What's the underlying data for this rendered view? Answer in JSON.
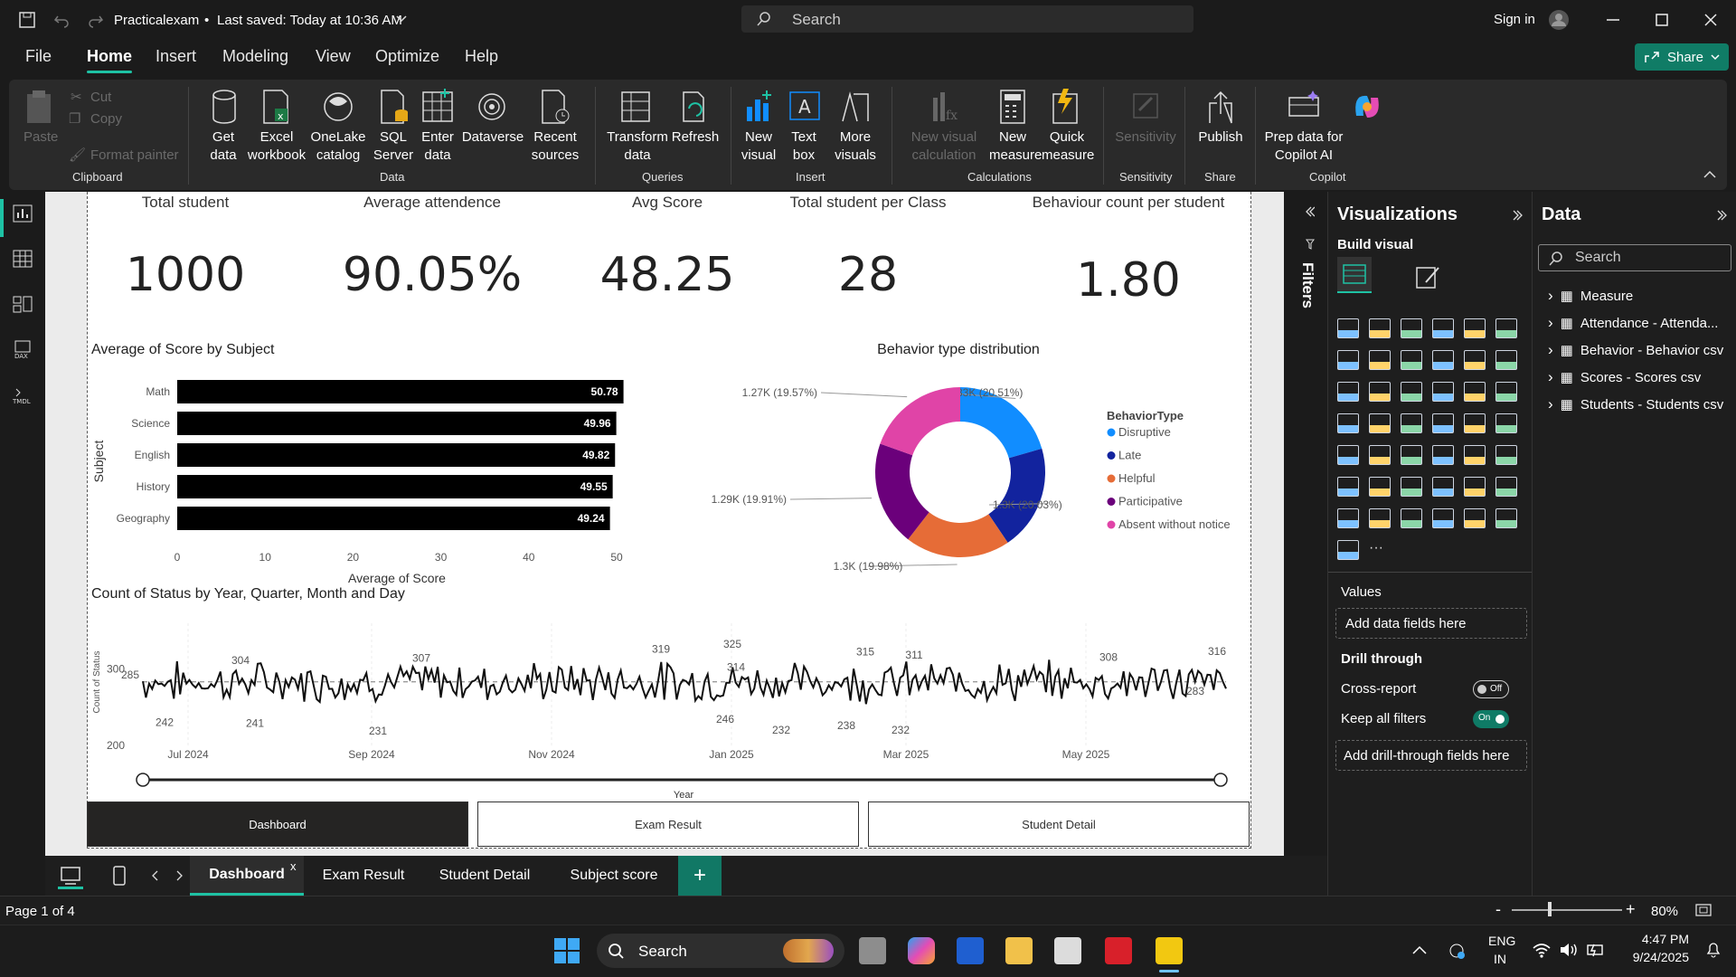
{
  "window": {
    "file_name": "Practicalexam",
    "saved": "Last saved: Today at 10:36 AM",
    "search_placeholder": "Search",
    "sign_in": "Sign in"
  },
  "menu": [
    "File",
    "Home",
    "Insert",
    "Modeling",
    "View",
    "Optimize",
    "Help"
  ],
  "share_label": "Share",
  "ribbon": {
    "clipboard": {
      "paste": "Paste",
      "cut": "Cut",
      "copy": "Copy",
      "format_painter": "Format painter",
      "group": "Clipboard"
    },
    "data": {
      "get_data": "Get data",
      "excel": "Excel workbook",
      "onelake": "OneLake catalog",
      "sql": "SQL Server",
      "enter": "Enter data",
      "dataverse": "Dataverse",
      "recent": "Recent sources",
      "group": "Data"
    },
    "queries": {
      "transform": "Transform data",
      "refresh": "Refresh",
      "group": "Queries"
    },
    "insert": {
      "new_visual": "New visual",
      "text_box": "Text box",
      "more": "More visuals",
      "group": "Insert"
    },
    "calculations": {
      "new_calc": "New visual calculation",
      "new_measure": "New measure",
      "quick_measure": "Quick measure",
      "group": "Calculations"
    },
    "sensitivity": {
      "label": "Sensitivity",
      "group": "Sensitivity"
    },
    "share": {
      "publish": "Publish",
      "group": "Share"
    },
    "copilot": {
      "prep": "Prep data for Copilot AI",
      "group": "Copilot"
    }
  },
  "cards": [
    {
      "title": "Total student",
      "value": "1000"
    },
    {
      "title": "Average attendence",
      "value": "90.05%"
    },
    {
      "title": "Avg Score",
      "value": "48.25"
    },
    {
      "title": "Total student per Class",
      "value": "28"
    },
    {
      "title": "Behaviour count per student",
      "value": "1.80"
    }
  ],
  "bar_chart": {
    "title": "Average of Score by Subject",
    "xlabel": "Average of Score",
    "ylabel": "Subject",
    "ticks": [
      "0",
      "10",
      "20",
      "30",
      "40",
      "50"
    ],
    "categories": [
      "Math",
      "Science",
      "English",
      "History",
      "Geography"
    ],
    "values": [
      50.78,
      49.96,
      49.82,
      49.55,
      49.24
    ],
    "labels": [
      "50.78",
      "49.96",
      "49.82",
      "49.55",
      "49.24"
    ],
    "color": "#000000"
  },
  "donut": {
    "title": "Behavior type distribution",
    "legend_title": "BehaviorType",
    "items": [
      {
        "name": "Disruptive",
        "label": "1.33K (20.51%)",
        "pct": 20.51,
        "color": "#118DFF"
      },
      {
        "name": "Late",
        "label": "1.3K (20.03%)",
        "pct": 20.03,
        "color": "#12239E"
      },
      {
        "name": "Helpful",
        "label": "1.3K (19.98%)",
        "pct": 19.98,
        "color": "#E66C37"
      },
      {
        "name": "Participative",
        "label": "1.29K (19.91%)",
        "pct": 19.91,
        "color": "#6B007B"
      },
      {
        "name": "Absent without notice",
        "label": "1.27K (19.57%)",
        "pct": 19.57,
        "color": "#E044A7"
      }
    ]
  },
  "line_chart": {
    "title": "Count of Status by Year, Quarter, Month and Day",
    "ylabel": "Count of Status",
    "xlabel": "Year",
    "yticks": [
      "300",
      "200"
    ],
    "xticks": [
      "Jul 2024",
      "Sep 2024",
      "Nov 2024",
      "Jan 2025",
      "Mar 2025",
      "May 2025"
    ],
    "annotations": [
      "285",
      "304",
      "307",
      "319",
      "325",
      "315",
      "311",
      "308",
      "316",
      "242",
      "241",
      "231",
      "246",
      "232",
      "238",
      "232",
      "283",
      "314"
    ],
    "ylim": [
      200,
      330
    ]
  },
  "nav_buttons": [
    "Dashboard",
    "Exam Result",
    "Student Detail"
  ],
  "filters_label": "Filters",
  "viz_pane": {
    "title": "Visualizations",
    "build": "Build visual",
    "values": "Values",
    "add_fields": "Add data fields here",
    "drill": "Drill through",
    "cross": "Cross-report",
    "cross_state": "Off",
    "keep": "Keep all filters",
    "keep_state": "On",
    "add_drill": "Add drill-through fields here"
  },
  "data_pane": {
    "title": "Data",
    "search": "Search",
    "tables": [
      "Measure",
      "Attendance - Attenda...",
      "Behavior - Behavior csv",
      "Scores - Scores csv",
      "Students - Students csv"
    ]
  },
  "tabs": [
    "Dashboard",
    "Exam Result",
    "Student Detail",
    "Subject score"
  ],
  "status": {
    "page": "Page 1 of 4",
    "zoom": "80%"
  },
  "taskbar": {
    "search": "Search",
    "lang1": "ENG",
    "lang2": "IN",
    "time": "4:47 PM",
    "date": "9/24/2025"
  }
}
